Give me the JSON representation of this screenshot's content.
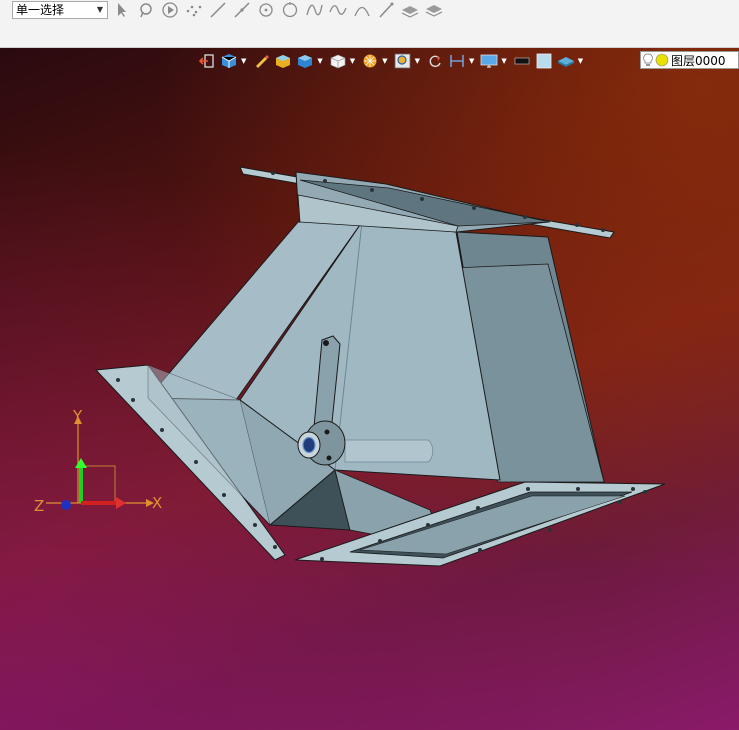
{
  "toolbar": {
    "selection_mode": "单一选择",
    "tools": [
      "select-arrow-icon",
      "select-lasso-icon",
      "play-circle-icon",
      "point-cloud-icon",
      "line-icon",
      "line-diagonal-icon",
      "circle-center-icon",
      "circle-icon",
      "spline-icon",
      "wave-curve-icon",
      "arc-icon",
      "slash-line-icon",
      "layers-stack-icon",
      "layers-flat-icon"
    ]
  },
  "view_toolbar": {
    "icons": [
      "exit-icon",
      "display-mode-icon",
      "marker-icon",
      "shaded-box-icon",
      "solid-cube-icon",
      "wire-cube-icon",
      "sun-render-icon",
      "zoom-view-icon",
      "rotate-icon",
      "dimension-icon",
      "monitor-icon",
      "black-color-swatch",
      "light-color-swatch",
      "plane-icon"
    ],
    "layer_label": "图层0000"
  },
  "triad": {
    "x_label": "X",
    "y_label": "Y",
    "z_label": "Z"
  },
  "colors": {
    "model": "#9fb8c2",
    "viewport_top": "#2a0a0f",
    "viewport_accent": "#8a1a6a"
  }
}
